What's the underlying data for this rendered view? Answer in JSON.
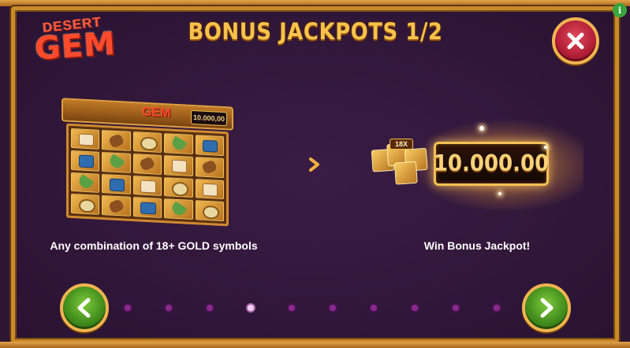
{
  "logo": {
    "line1": "DESERT",
    "line2": "GEM"
  },
  "title": "BONUS JACKPOTS 1/2",
  "controls": {
    "close_icon": "close-x-icon",
    "info_label": "i",
    "prev_icon": "chevron-left-icon",
    "next_icon": "chevron-right-icon"
  },
  "left_panel": {
    "mini_logo": "GEM",
    "mini_jackpot": "10.000,00",
    "caption": "Any combination of 18+ GOLD symbols"
  },
  "right_panel": {
    "badge": "18X",
    "jackpot_value": "10.000.00",
    "caption": "Win Bonus Jackpot!"
  },
  "pagination": {
    "total_dots": 10,
    "active_index": 3
  },
  "colors": {
    "accent_gold": "#f8c24a",
    "close_red": "#b01e36",
    "nav_green": "#3f8a1c",
    "dot_inactive": "#8a2a8e",
    "dot_active": "#f0d0f0"
  }
}
